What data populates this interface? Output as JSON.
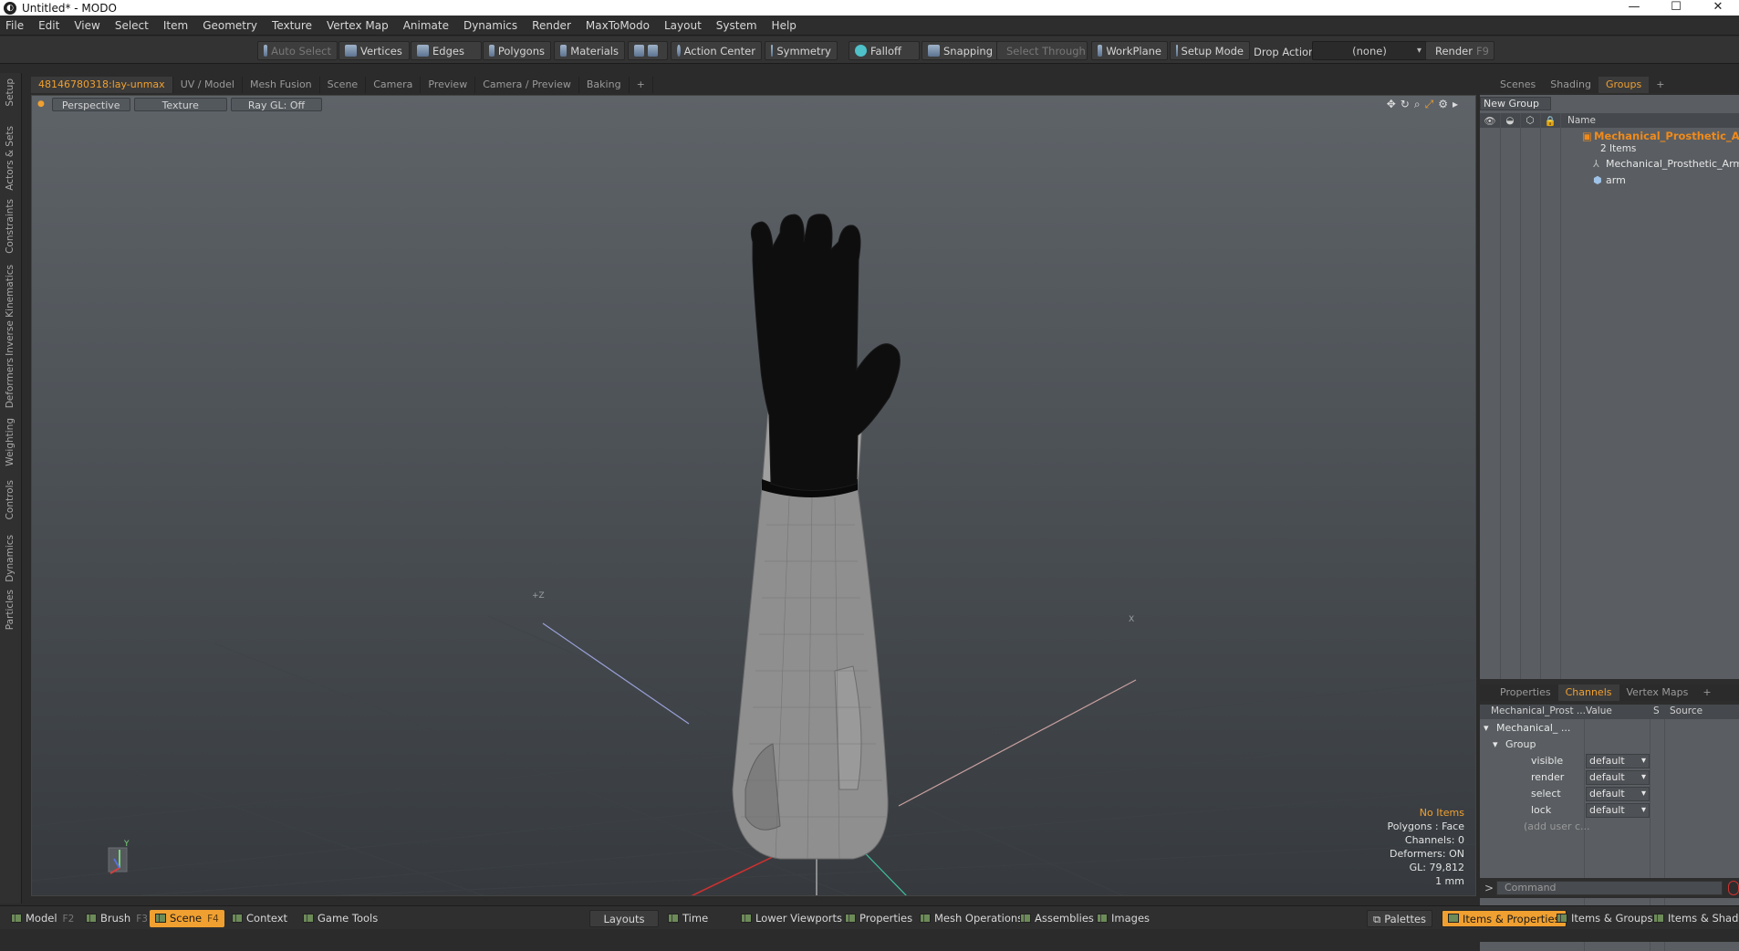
{
  "window": {
    "title": "Untitled* - MODO",
    "app_icon": "modo-logo-icon",
    "controls": [
      "—",
      "☐",
      "✕"
    ]
  },
  "menu": [
    "File",
    "Edit",
    "View",
    "Select",
    "Item",
    "Geometry",
    "Texture",
    "Vertex Map",
    "Animate",
    "Dynamics",
    "Render",
    "MaxToModo",
    "Layout",
    "System",
    "Help"
  ],
  "toolbar": {
    "auto_select": "Auto Select",
    "vertices": "Vertices",
    "edges": "Edges",
    "polygons": "Polygons",
    "materials": "Materials",
    "action_center": "Action Center",
    "symmetry": "Symmetry",
    "falloff": "Falloff",
    "snapping": "Snapping",
    "select_through": "Select Through",
    "workplane": "WorkPlane",
    "setup_mode": "Setup Mode",
    "drop_action_label": "Drop Action",
    "drop_action_value": "(none)",
    "render": "Render",
    "render_key": "F9"
  },
  "left_tabs": [
    "Setup",
    "Actors & Sets",
    "Constraints",
    "Inverse Kinematics",
    "Deformers",
    "Weighting",
    "Controls",
    "Dynamics",
    "Particles"
  ],
  "viewport_tabs": [
    "48146780318:lay-unmax",
    "UV / Model",
    "Mesh Fusion",
    "Scene",
    "Camera",
    "Preview",
    "Camera / Preview",
    "Baking",
    "+"
  ],
  "viewport": {
    "view_mode": "Perspective",
    "shading": "Texture",
    "raygl": "Ray GL: Off",
    "axis_labels": {
      "y": "Y",
      "z": "+Z",
      "x": "X"
    },
    "stats": {
      "items": "No Items",
      "polygons": "Polygons : Face",
      "channels": "Channels: 0",
      "deformers": "Deformers: ON",
      "gl": "GL: 79,812",
      "unit": "1 mm"
    }
  },
  "right_top_tabs": [
    "Scenes",
    "Shading",
    "Groups",
    "+"
  ],
  "groups": {
    "new_group": "New Group",
    "name_header": "Name",
    "root": "Mechanical_Prosthetic_A...",
    "count": "2 Items",
    "children": [
      "Mechanical_Prosthetic_Arm",
      "arm"
    ]
  },
  "right_bottom_tabs": [
    "Properties",
    "Channels",
    "Vertex Maps",
    "+"
  ],
  "channels": {
    "headers": [
      "Mechanical_Prost ...",
      "Value",
      "S",
      "Source"
    ],
    "root": "Mechanical_ ...",
    "group": "Group",
    "rows": [
      {
        "name": "visible",
        "value": "default"
      },
      {
        "name": "render",
        "value": "default"
      },
      {
        "name": "select",
        "value": "default"
      },
      {
        "name": "lock",
        "value": "default"
      }
    ],
    "add_user": "(add user c..."
  },
  "command": {
    "prompt": ">",
    "placeholder": "Command"
  },
  "bottom_left": [
    {
      "label": "Model",
      "key": "F2"
    },
    {
      "label": "Brush",
      "key": "F3"
    },
    {
      "label": "Scene",
      "key": "F4"
    },
    {
      "label": "Context",
      "key": ""
    },
    {
      "label": "Game Tools",
      "key": ""
    }
  ],
  "bottom_mid": [
    "Layouts",
    "Time",
    "Lower Viewports",
    "Properties",
    "Mesh Operations",
    "Assemblies",
    "Images"
  ],
  "bottom_right": [
    "Palettes",
    "Items & Properties",
    "Items & Groups",
    "Items & Shading"
  ],
  "colors": {
    "accent": "#f0a030",
    "orange_item": "#f08a1a",
    "viewport_top": "#5e6368",
    "viewport_bottom": "#363a3e"
  }
}
